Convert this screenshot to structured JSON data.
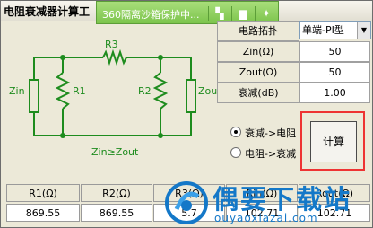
{
  "app": {
    "title": "电阻衰减器计算工"
  },
  "sandbox": {
    "text": "360隔离沙箱保护中...",
    "icons": [
      "sandbox-folder-icon",
      "folder-icon",
      "pin-icon"
    ]
  },
  "schematic": {
    "r1": "R1",
    "r2": "R2",
    "r3": "R3",
    "zin": "Zin",
    "zout": "Zout",
    "caption": "Zin≥Zout"
  },
  "params": {
    "topology_label": "电路拓扑",
    "topology_value": "单端-PI型",
    "rows": [
      {
        "label": "Zin(Ω)",
        "value": "50"
      },
      {
        "label": "Zout(Ω)",
        "value": "50"
      },
      {
        "label": "衰减(dB)",
        "value": "1.00"
      }
    ]
  },
  "mode": {
    "options": [
      {
        "label": "衰减->电阻",
        "selected": true
      },
      {
        "label": "电阻->衰减",
        "selected": false
      }
    ]
  },
  "calc_button": "计算",
  "results": {
    "headers": [
      "R1(Ω)",
      "R2(Ω)",
      "R3(Ω)",
      "Rin(Ω)",
      "Rout(Ω)"
    ],
    "values": [
      "869.55",
      "869.55",
      "5.7",
      "102.71",
      "102.71"
    ]
  },
  "watermark": {
    "text": "偶要下载站",
    "sub": "ouyaoxiazai.com"
  },
  "colors": {
    "highlight": "#e33333",
    "sandbox_green": "#7cc44c",
    "circuit_green": "#1e8c1e",
    "watermark_blue": "#1478c8"
  }
}
